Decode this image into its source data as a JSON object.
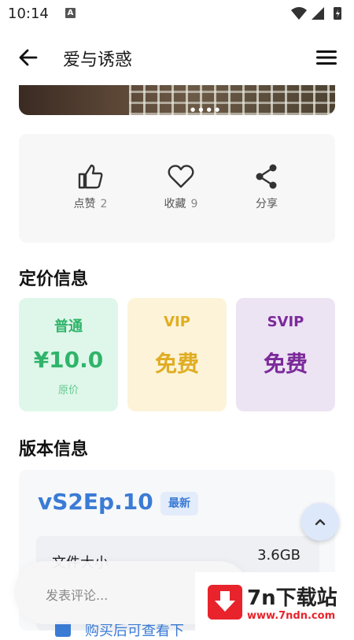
{
  "status_bar": {
    "time": "10:14",
    "notification_letter": "A"
  },
  "app_bar": {
    "title": "爱与诱惑"
  },
  "actions": [
    {
      "label": "点赞",
      "count": "2",
      "icon": "thumbs-up-icon"
    },
    {
      "label": "收藏",
      "count": "9",
      "icon": "heart-icon"
    },
    {
      "label": "分享",
      "count": "",
      "icon": "share-icon"
    }
  ],
  "pricing": {
    "title": "定价信息",
    "tiers": [
      {
        "tier": "普通",
        "value": "¥10.0",
        "sub": "原价",
        "bg": "#dff7ea",
        "color": "#2fb46a"
      },
      {
        "tier": "VIP",
        "value": "免费",
        "sub": "",
        "bg": "#fcf3d9",
        "color": "#e0ad22"
      },
      {
        "tier": "SVIP",
        "value": "免费",
        "sub": "",
        "bg": "#ece3f3",
        "color": "#7b2a9a"
      }
    ]
  },
  "version": {
    "title": "版本信息",
    "name": "vS2Ep.10",
    "badge": "最新",
    "file_size_label": "文件大小",
    "file_size_value": "3.6GB",
    "buy_hint": "购买后可查看下"
  },
  "comment": {
    "placeholder": "发表评论..."
  },
  "watermark": {
    "text": "7n下载站",
    "url": "www.7ndn.com"
  },
  "colors": {
    "accent": "#3a7bd5",
    "fab_bg": "#dde8fb"
  }
}
